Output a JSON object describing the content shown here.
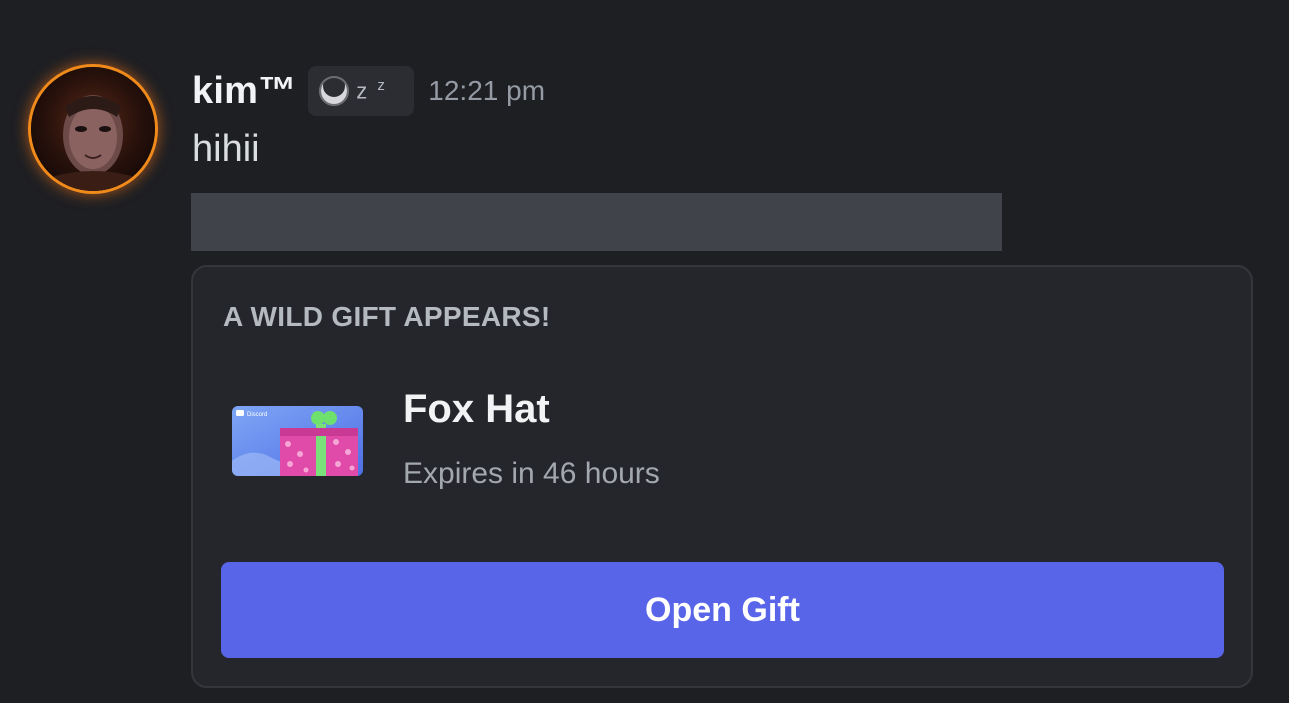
{
  "message": {
    "username": "kim™",
    "status_text": "z",
    "status_text_small": "z",
    "timestamp": "12:21 pm",
    "content": "hihii"
  },
  "gift": {
    "heading": "A WILD GIFT APPEARS!",
    "title": "Fox Hat",
    "expiry": "Expires in 46 hours",
    "thumbnail_brand": "Discord",
    "button_label": "Open Gift"
  },
  "colors": {
    "background": "#1e1f23",
    "card": "#25262c",
    "button": "#5865e8",
    "avatar_ring": "#f08a1a"
  },
  "icons": {
    "status": "moon-crescent-icon",
    "avatar": "user-avatar"
  }
}
